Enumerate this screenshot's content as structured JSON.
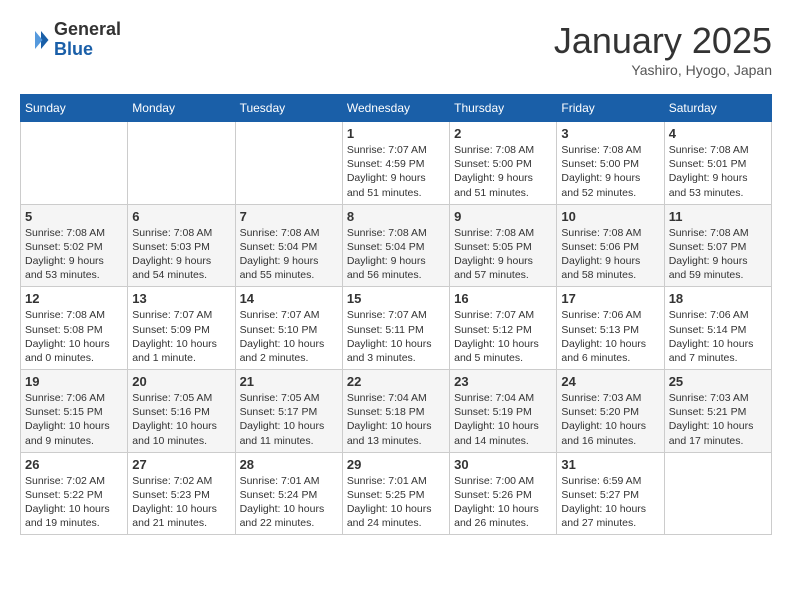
{
  "header": {
    "logo_general": "General",
    "logo_blue": "Blue",
    "month_title": "January 2025",
    "location": "Yashiro, Hyogo, Japan"
  },
  "days_of_week": [
    "Sunday",
    "Monday",
    "Tuesday",
    "Wednesday",
    "Thursday",
    "Friday",
    "Saturday"
  ],
  "weeks": [
    [
      {
        "day": "",
        "info": ""
      },
      {
        "day": "",
        "info": ""
      },
      {
        "day": "",
        "info": ""
      },
      {
        "day": "1",
        "info": "Sunrise: 7:07 AM\nSunset: 4:59 PM\nDaylight: 9 hours and 51 minutes."
      },
      {
        "day": "2",
        "info": "Sunrise: 7:08 AM\nSunset: 5:00 PM\nDaylight: 9 hours and 51 minutes."
      },
      {
        "day": "3",
        "info": "Sunrise: 7:08 AM\nSunset: 5:00 PM\nDaylight: 9 hours and 52 minutes."
      },
      {
        "day": "4",
        "info": "Sunrise: 7:08 AM\nSunset: 5:01 PM\nDaylight: 9 hours and 53 minutes."
      }
    ],
    [
      {
        "day": "5",
        "info": "Sunrise: 7:08 AM\nSunset: 5:02 PM\nDaylight: 9 hours and 53 minutes."
      },
      {
        "day": "6",
        "info": "Sunrise: 7:08 AM\nSunset: 5:03 PM\nDaylight: 9 hours and 54 minutes."
      },
      {
        "day": "7",
        "info": "Sunrise: 7:08 AM\nSunset: 5:04 PM\nDaylight: 9 hours and 55 minutes."
      },
      {
        "day": "8",
        "info": "Sunrise: 7:08 AM\nSunset: 5:04 PM\nDaylight: 9 hours and 56 minutes."
      },
      {
        "day": "9",
        "info": "Sunrise: 7:08 AM\nSunset: 5:05 PM\nDaylight: 9 hours and 57 minutes."
      },
      {
        "day": "10",
        "info": "Sunrise: 7:08 AM\nSunset: 5:06 PM\nDaylight: 9 hours and 58 minutes."
      },
      {
        "day": "11",
        "info": "Sunrise: 7:08 AM\nSunset: 5:07 PM\nDaylight: 9 hours and 59 minutes."
      }
    ],
    [
      {
        "day": "12",
        "info": "Sunrise: 7:08 AM\nSunset: 5:08 PM\nDaylight: 10 hours and 0 minutes."
      },
      {
        "day": "13",
        "info": "Sunrise: 7:07 AM\nSunset: 5:09 PM\nDaylight: 10 hours and 1 minute."
      },
      {
        "day": "14",
        "info": "Sunrise: 7:07 AM\nSunset: 5:10 PM\nDaylight: 10 hours and 2 minutes."
      },
      {
        "day": "15",
        "info": "Sunrise: 7:07 AM\nSunset: 5:11 PM\nDaylight: 10 hours and 3 minutes."
      },
      {
        "day": "16",
        "info": "Sunrise: 7:07 AM\nSunset: 5:12 PM\nDaylight: 10 hours and 5 minutes."
      },
      {
        "day": "17",
        "info": "Sunrise: 7:06 AM\nSunset: 5:13 PM\nDaylight: 10 hours and 6 minutes."
      },
      {
        "day": "18",
        "info": "Sunrise: 7:06 AM\nSunset: 5:14 PM\nDaylight: 10 hours and 7 minutes."
      }
    ],
    [
      {
        "day": "19",
        "info": "Sunrise: 7:06 AM\nSunset: 5:15 PM\nDaylight: 10 hours and 9 minutes."
      },
      {
        "day": "20",
        "info": "Sunrise: 7:05 AM\nSunset: 5:16 PM\nDaylight: 10 hours and 10 minutes."
      },
      {
        "day": "21",
        "info": "Sunrise: 7:05 AM\nSunset: 5:17 PM\nDaylight: 10 hours and 11 minutes."
      },
      {
        "day": "22",
        "info": "Sunrise: 7:04 AM\nSunset: 5:18 PM\nDaylight: 10 hours and 13 minutes."
      },
      {
        "day": "23",
        "info": "Sunrise: 7:04 AM\nSunset: 5:19 PM\nDaylight: 10 hours and 14 minutes."
      },
      {
        "day": "24",
        "info": "Sunrise: 7:03 AM\nSunset: 5:20 PM\nDaylight: 10 hours and 16 minutes."
      },
      {
        "day": "25",
        "info": "Sunrise: 7:03 AM\nSunset: 5:21 PM\nDaylight: 10 hours and 17 minutes."
      }
    ],
    [
      {
        "day": "26",
        "info": "Sunrise: 7:02 AM\nSunset: 5:22 PM\nDaylight: 10 hours and 19 minutes."
      },
      {
        "day": "27",
        "info": "Sunrise: 7:02 AM\nSunset: 5:23 PM\nDaylight: 10 hours and 21 minutes."
      },
      {
        "day": "28",
        "info": "Sunrise: 7:01 AM\nSunset: 5:24 PM\nDaylight: 10 hours and 22 minutes."
      },
      {
        "day": "29",
        "info": "Sunrise: 7:01 AM\nSunset: 5:25 PM\nDaylight: 10 hours and 24 minutes."
      },
      {
        "day": "30",
        "info": "Sunrise: 7:00 AM\nSunset: 5:26 PM\nDaylight: 10 hours and 26 minutes."
      },
      {
        "day": "31",
        "info": "Sunrise: 6:59 AM\nSunset: 5:27 PM\nDaylight: 10 hours and 27 minutes."
      },
      {
        "day": "",
        "info": ""
      }
    ]
  ]
}
